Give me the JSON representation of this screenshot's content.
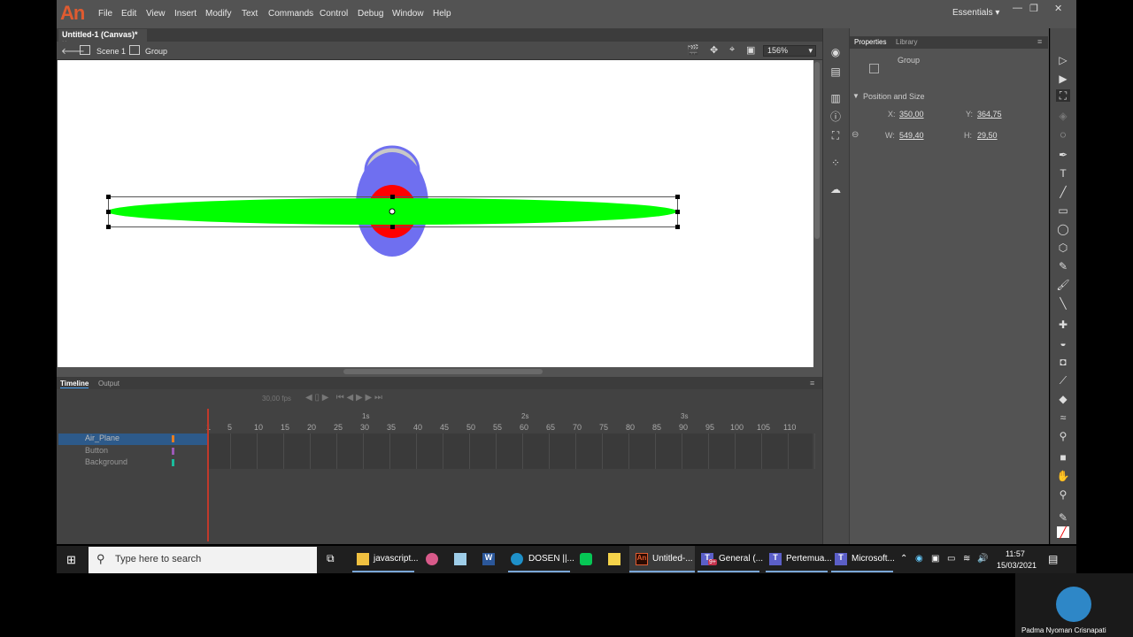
{
  "app": {
    "logo": "An",
    "workspace": "Essentials"
  },
  "menu": [
    "File",
    "Edit",
    "View",
    "Insert",
    "Modify",
    "Text",
    "Commands",
    "Control",
    "Debug",
    "Window",
    "Help"
  ],
  "document": {
    "tab": "Untitled-1 (Canvas)*",
    "scene": "Scene 1",
    "group": "Group",
    "zoom": "156%"
  },
  "timeline": {
    "tab_timeline": "Timeline",
    "tab_output": "Output",
    "fps": "30,00 fps",
    "rulers": [
      "1",
      "5",
      "10",
      "15",
      "20",
      "25",
      "30",
      "35",
      "40",
      "45",
      "50",
      "55",
      "60",
      "65",
      "70",
      "75",
      "80",
      "85",
      "90",
      "95",
      "100",
      "105",
      "110"
    ],
    "seconds": [
      "1s",
      "2s",
      "3s"
    ],
    "layers": [
      "Air_Plane",
      "Button",
      "Background"
    ]
  },
  "properties": {
    "tab_props": "Properties",
    "tab_library": "Library",
    "type": "Group",
    "section": "Position and Size",
    "x_label": "X:",
    "x": "350,00",
    "y_label": "Y:",
    "y": "364,75",
    "w_label": "W:",
    "w": "549,40",
    "h_label": "H:",
    "h": "29,50"
  },
  "taskbar": {
    "search_placeholder": "Type here to search",
    "apps": [
      "javascript...",
      "DOSEN ||...",
      "Untitled-...",
      "General (...",
      "Pertemua...",
      "Microsoft..."
    ],
    "time": "11:57",
    "date": "15/03/2021",
    "badge": "9+"
  },
  "webcam": {
    "name": "Padma Nyoman Crisnapati"
  },
  "colors": {
    "accent": "#e05b30",
    "wing": "#00ff00",
    "body": "#6f6ff0",
    "nose": "#ff0000",
    "canopy": "#c8c8c8"
  }
}
